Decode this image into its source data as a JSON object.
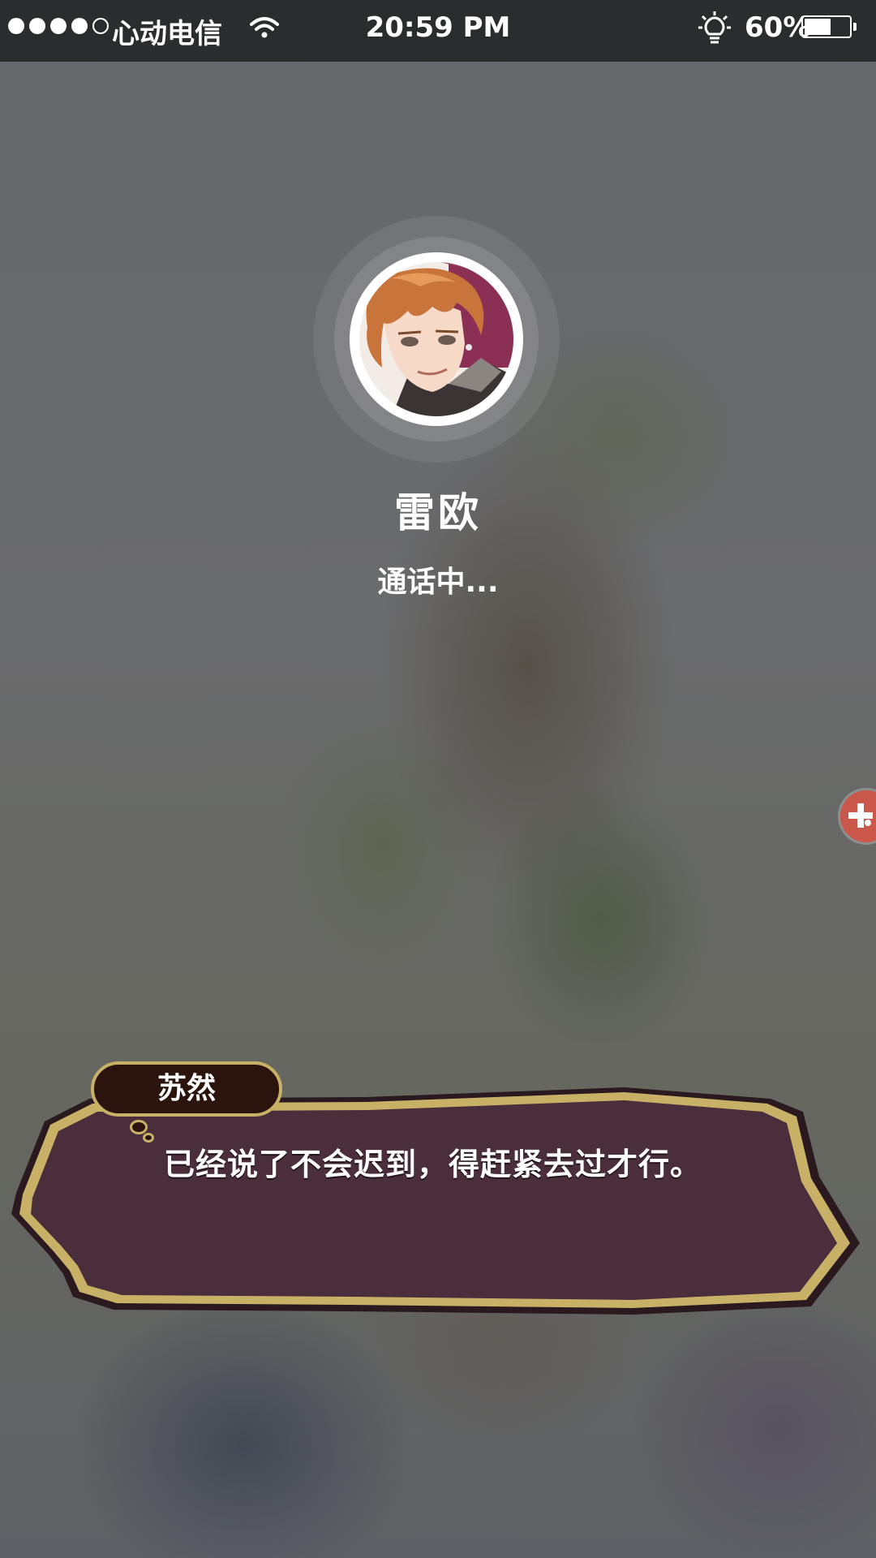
{
  "status_bar": {
    "signal_dots": [
      true,
      true,
      true,
      true,
      false
    ],
    "carrier": "心动电信",
    "time": "20:59 PM",
    "battery_percent_label": "60%",
    "battery_level": 0.6,
    "icons": [
      "wifi-icon",
      "lightbulb-icon",
      "battery-icon"
    ]
  },
  "call": {
    "caller_name": "雷欧",
    "status": "通话中..."
  },
  "dialogue": {
    "speaker": "苏然",
    "text": "已经说了不会迟到，得赶紧去过才行。"
  },
  "floating_widget": {
    "icon": "plus-icon",
    "color": "#c9574a"
  },
  "colors": {
    "status_bar_bg": "#2b2c2e",
    "dialog_fill": "#4a2e3c",
    "dialog_border": "#c9b067",
    "tag_fill": "#2a140d"
  }
}
